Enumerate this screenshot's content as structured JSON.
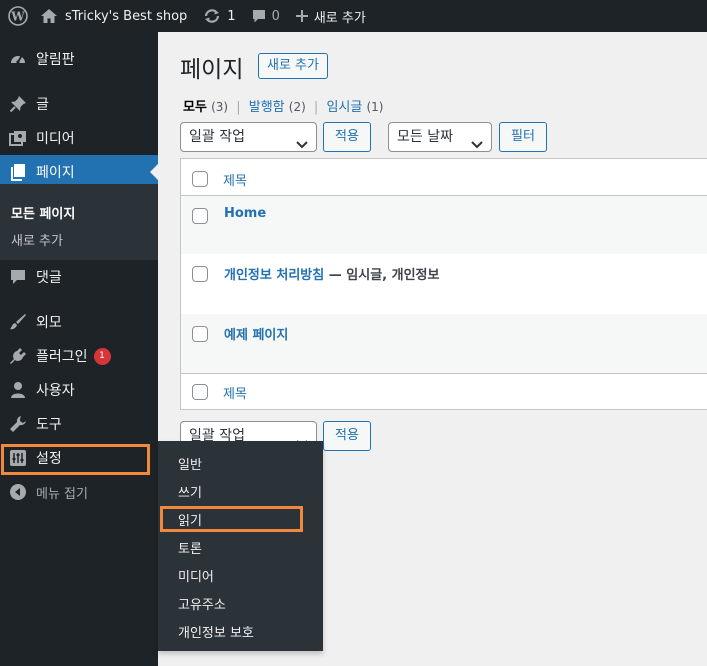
{
  "adminbar": {
    "site_name": "sTricky's Best shop",
    "updates_count": "1",
    "comments_count": "0",
    "new_label": "새로 추가"
  },
  "sidebar": {
    "items": [
      {
        "label": "알림판",
        "icon": "dashboard-icon"
      },
      {
        "label": "글",
        "icon": "pin-icon"
      },
      {
        "label": "미디어",
        "icon": "media-icon"
      },
      {
        "label": "페이지",
        "icon": "page-icon"
      },
      {
        "label": "댓글",
        "icon": "comment-icon"
      },
      {
        "label": "외모",
        "icon": "brush-icon"
      },
      {
        "label": "플러그인",
        "icon": "plugin-icon",
        "badge": "1"
      },
      {
        "label": "사용자",
        "icon": "user-icon"
      },
      {
        "label": "도구",
        "icon": "wrench-icon"
      },
      {
        "label": "설정",
        "icon": "settings-icon"
      },
      {
        "label": "메뉴 접기",
        "icon": "collapse-icon"
      }
    ],
    "submenu": [
      "모든 페이지",
      "새로 추가"
    ]
  },
  "flyout": [
    "일반",
    "쓰기",
    "읽기",
    "토론",
    "미디어",
    "고유주소",
    "개인정보 보호"
  ],
  "main": {
    "title": "페이지",
    "new_button": "새로 추가",
    "views": [
      {
        "label": "모두",
        "count": "(3)"
      },
      {
        "label": "발행함",
        "count": "(2)"
      },
      {
        "label": "임시글",
        "count": "(1)"
      }
    ],
    "bulk_action": "일괄 작업",
    "apply": "적용",
    "all_dates": "모든 날짜",
    "filter": "필터",
    "column_title": "제목",
    "rows": [
      {
        "title": "Home",
        "state": ""
      },
      {
        "title": "개인정보 처리방침",
        "state": " — 임시글, 개인정보"
      },
      {
        "title": "예제 페이지",
        "state": ""
      }
    ]
  },
  "colors": {
    "adminbar_bg": "#1d2327",
    "accent": "#2271b1",
    "highlight": "#f0883e",
    "badge": "#d63638"
  }
}
